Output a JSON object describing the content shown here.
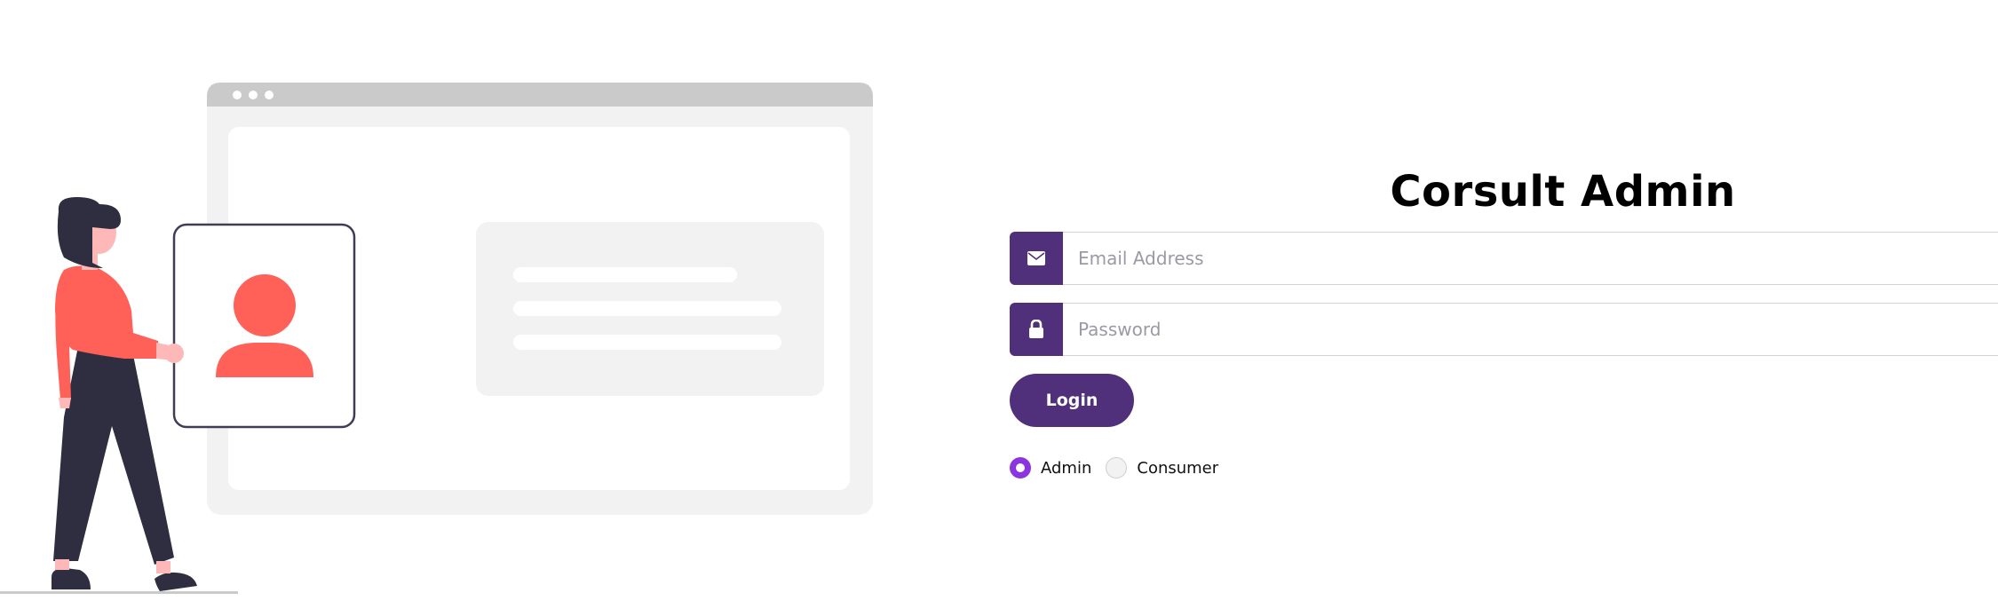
{
  "form": {
    "title": "Corsult Admin",
    "email_placeholder": "Email Address",
    "email_value": "",
    "password_placeholder": "Password",
    "password_value": "",
    "login_label": "Login",
    "roles": [
      {
        "label": "Admin",
        "selected": true
      },
      {
        "label": "Consumer",
        "selected": false
      }
    ]
  },
  "colors": {
    "brand": "#50307a",
    "radio_accent": "#8a35e0",
    "figure_accent": "#ff6159",
    "figure_dark": "#2f2e41"
  },
  "icons": {
    "email": "envelope-icon",
    "password": "lock-icon"
  }
}
